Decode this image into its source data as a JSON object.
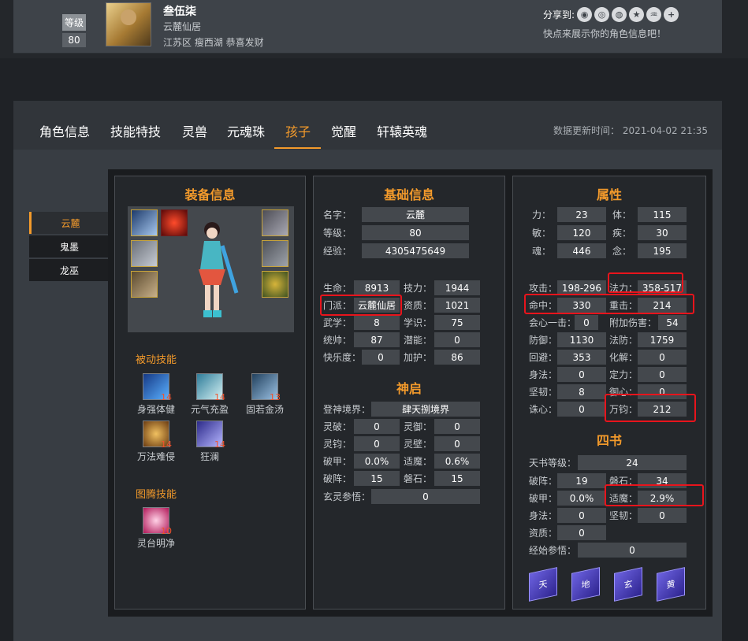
{
  "header": {
    "level_label": "等级",
    "level_value": "80",
    "name": "叁伍柒",
    "server": "云麓仙居",
    "location": "江苏区 瘦西湖 恭喜发财",
    "share_label": "分享到:",
    "share_tip": "快点来展示你的角色信息吧！",
    "share_icons": [
      "wechat-icon",
      "qq-icon",
      "weibo-icon",
      "qzone-icon",
      "renren-icon",
      "more-icon"
    ]
  },
  "tabs": [
    "角色信息",
    "技能特技",
    "灵兽",
    "元魂珠",
    "孩子",
    "觉醒",
    "轩辕英魂"
  ],
  "active_tab": "孩子",
  "update_time": "数据更新时间： 2021-04-02 21:35",
  "children": [
    "云麓",
    "鬼墨",
    "龙巫"
  ],
  "equip_panel": {
    "title": "装备信息",
    "passive_title": "被动技能",
    "passive": [
      {
        "name": "身强体健",
        "level": "14"
      },
      {
        "name": "元气充盈",
        "level": "14"
      },
      {
        "name": "固若金汤",
        "level": "13"
      },
      {
        "name": "万法难侵",
        "level": "14"
      },
      {
        "name": "狂澜",
        "level": "14"
      }
    ],
    "totem_title": "图腾技能",
    "totem": [
      {
        "name": "灵台明净",
        "level": "10"
      }
    ]
  },
  "basic_panel": {
    "title": "基础信息",
    "name_label": "名字：",
    "name_value": "云麓",
    "level_label": "等级：",
    "level_value": "80",
    "exp_label": "经验：",
    "exp_value": "4305475649",
    "stats": [
      [
        "生命：",
        "8913",
        "技力：",
        "1944"
      ],
      [
        "门派：",
        "云麓仙居",
        "资质：",
        "1021"
      ],
      [
        "武学：",
        "8",
        "学识：",
        "75"
      ],
      [
        "统帅：",
        "87",
        "潜能：",
        "0"
      ],
      [
        "快乐度：",
        "0",
        "加护：",
        "86"
      ]
    ],
    "shenqi_title": "神启",
    "realm_label": "登神境界：",
    "realm_value": "肆天捌境界",
    "shenqi": [
      [
        "灵破：",
        "0",
        "灵御：",
        "0"
      ],
      [
        "灵钧：",
        "0",
        "灵壁：",
        "0"
      ],
      [
        "破甲：",
        "0.0%",
        "适魔：",
        "0.6%"
      ],
      [
        "破阵：",
        "15",
        "磐石：",
        "15"
      ]
    ],
    "xuanling_label": "玄灵参悟：",
    "xuanling_value": "0"
  },
  "attr_panel": {
    "title": "属性",
    "base": [
      [
        "力：",
        "23",
        "体：",
        "115"
      ],
      [
        "敏：",
        "120",
        "疾：",
        "30"
      ],
      [
        "魂：",
        "446",
        "念：",
        "195"
      ]
    ],
    "combat": [
      [
        "攻击：",
        "198-296",
        "法力：",
        "358-517"
      ],
      [
        "命中：",
        "330",
        "重击：",
        "214"
      ],
      [
        "会心一击：",
        "0",
        "附加伤害：",
        "54"
      ],
      [
        "防御：",
        "1130",
        "法防：",
        "1759"
      ],
      [
        "回避：",
        "353",
        "化解：",
        "0"
      ],
      [
        "身法：",
        "0",
        "定力：",
        "0"
      ],
      [
        "坚韧：",
        "8",
        "御心：",
        "0"
      ],
      [
        "诛心：",
        "0",
        "万钧：",
        "212"
      ]
    ],
    "sishu_title": "四书",
    "tianshu_label": "天书等级：",
    "tianshu_value": "24",
    "sishu": [
      [
        "破阵：",
        "19",
        "磐石：",
        "34"
      ],
      [
        "破甲：",
        "0.0%",
        "适魔：",
        "2.9%"
      ],
      [
        "身法：",
        "0",
        "坚韧：",
        "0"
      ]
    ],
    "zizhi_label": "资质：",
    "zizhi_value": "0",
    "jingshi_label": "经始参悟：",
    "jingshi_value": "0",
    "books": [
      "天",
      "地",
      "玄",
      "黄"
    ]
  }
}
